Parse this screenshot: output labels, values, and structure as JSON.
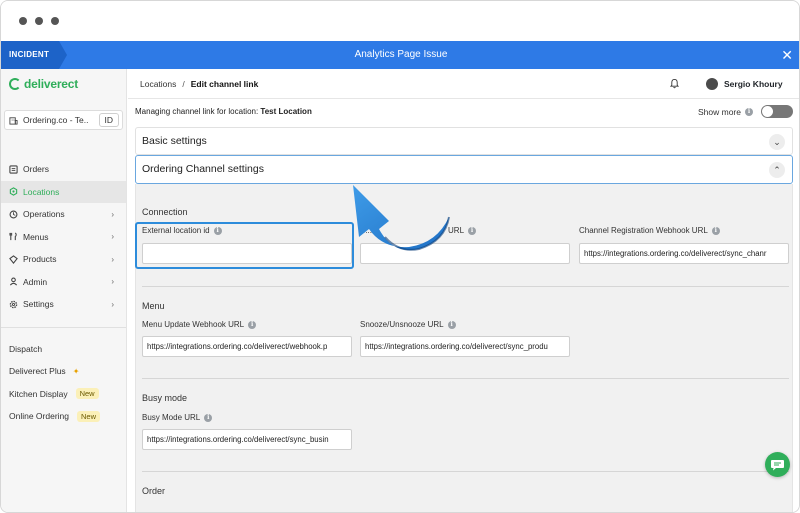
{
  "banner": {
    "tag": "INCIDENT",
    "title": "Analytics Page Issue",
    "close": "✕"
  },
  "brand": {
    "name": "deliverect",
    "color": "#2fae5a"
  },
  "location_selector": {
    "value": "Ordering.co - Te...",
    "id_label": "ID"
  },
  "sidebar": {
    "primary": [
      {
        "label": "Orders",
        "icon": "orders-icon",
        "active": false,
        "chevron": false
      },
      {
        "label": "Locations",
        "icon": "location-icon",
        "active": true,
        "chevron": false
      },
      {
        "label": "Operations",
        "icon": "operations-icon",
        "active": false,
        "chevron": true
      },
      {
        "label": "Menus",
        "icon": "menus-icon",
        "active": false,
        "chevron": true
      },
      {
        "label": "Products",
        "icon": "products-icon",
        "active": false,
        "chevron": true
      },
      {
        "label": "Admin",
        "icon": "admin-icon",
        "active": false,
        "chevron": true
      },
      {
        "label": "Settings",
        "icon": "gear-icon",
        "active": false,
        "chevron": true
      }
    ],
    "secondary": [
      {
        "label": "Dispatch",
        "badge": ""
      },
      {
        "label": "Deliverect Plus",
        "badge": ""
      },
      {
        "label": "Kitchen Display",
        "badge": "New"
      },
      {
        "label": "Online Ordering",
        "badge": "New"
      }
    ]
  },
  "breadcrumb": {
    "parent": "Locations",
    "separator": "/",
    "current": "Edit channel link"
  },
  "user": {
    "name": "Sergio Khoury"
  },
  "managing": {
    "prefix": "Managing channel link for location:",
    "location": "Test Location"
  },
  "show_more": {
    "label": "Show more",
    "enabled": false
  },
  "sections": {
    "basic": {
      "title": "Basic settings"
    },
    "ordering": {
      "title": "Ordering Channel settings"
    }
  },
  "connection": {
    "title": "Connection",
    "external_location_id": {
      "label": "External location id",
      "value": ""
    },
    "second_field": {
      "label": "S...",
      "visible_suffix": "URL",
      "value": ""
    },
    "channel_registration": {
      "label": "Channel Registration Webhook URL",
      "value": "https://integrations.ordering.co/deliverect/sync_chanr"
    }
  },
  "menu": {
    "title": "Menu",
    "menu_update": {
      "label": "Menu Update Webhook URL",
      "value": "https://integrations.ordering.co/deliverect/webhook.p"
    },
    "snooze": {
      "label": "Snooze/Unsnooze URL",
      "value": "https://integrations.ordering.co/deliverect/sync_produ"
    }
  },
  "busy": {
    "title": "Busy mode",
    "busy_url": {
      "label": "Busy Mode URL",
      "value": "https://integrations.ordering.co/deliverect/sync_busin"
    }
  },
  "order": {
    "title": "Order"
  },
  "colors": {
    "accent_blue": "#2e7ae6",
    "highlight": "#2d8cdb",
    "green": "#2fae5a"
  }
}
